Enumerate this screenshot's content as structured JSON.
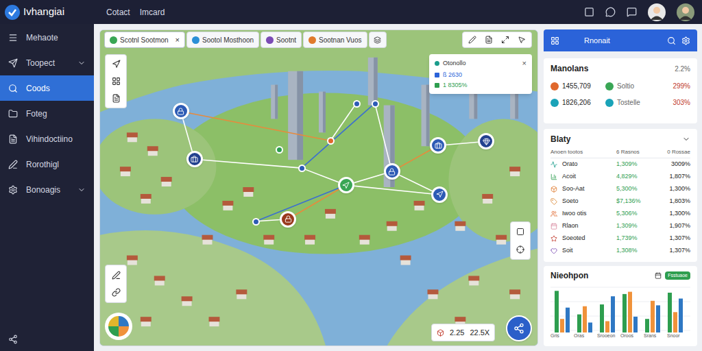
{
  "app": {
    "name": "Ivhangiai"
  },
  "top_menu": [
    "Cotact",
    "Imcard"
  ],
  "sidebar": {
    "items": [
      {
        "label": "Mehaote",
        "selected": false,
        "expandable": false
      },
      {
        "label": "Toopect",
        "selected": false,
        "expandable": true
      },
      {
        "label": "Coods",
        "selected": true,
        "expandable": false
      },
      {
        "label": "Foteg",
        "selected": false,
        "expandable": false
      },
      {
        "label": "Vihindoctiino",
        "selected": false,
        "expandable": false
      },
      {
        "label": "Rorothigl",
        "selected": false,
        "expandable": false
      },
      {
        "label": "Bonoagis",
        "selected": false,
        "expandable": true
      }
    ]
  },
  "map": {
    "tabs": [
      {
        "label": "Scotnl Sootmon",
        "selected": true,
        "closable": true,
        "color": "#3aa655"
      },
      {
        "label": "Sootol Mosthoon",
        "selected": false,
        "closable": false,
        "color": "#2b8fd6"
      },
      {
        "label": "Sootnt",
        "selected": false,
        "closable": false,
        "color": "#7b4bb5"
      },
      {
        "label": "Sootnan Vuos",
        "selected": false,
        "closable": false,
        "color": "#e07a2c"
      }
    ],
    "tab_close": "×",
    "popup": {
      "title": "Otonollo",
      "close": "×",
      "rows": [
        {
          "label": "ß 2630",
          "color": "#2b63d9"
        },
        {
          "label": "1 8305%",
          "color": "#2e9e4f"
        }
      ]
    },
    "pins": [
      {
        "kind": "marker",
        "color": "#2d5bb5"
      },
      {
        "kind": "marker",
        "color": "#23418f"
      },
      {
        "kind": "dot",
        "color": "#2e9e4f"
      },
      {
        "kind": "dot",
        "color": "#2d5bb5"
      },
      {
        "kind": "dot",
        "color": "#e0682c"
      },
      {
        "kind": "dot",
        "color": "#2d5bb5"
      },
      {
        "kind": "dot",
        "color": "#2d5bb5"
      },
      {
        "kind": "marker",
        "color": "#3aa655"
      },
      {
        "kind": "marker",
        "color": "#2d5bb5"
      },
      {
        "kind": "marker",
        "color": "#2d5bb5"
      },
      {
        "kind": "marker",
        "color": "#23418f"
      },
      {
        "kind": "marker",
        "color": "#2d5bb5"
      },
      {
        "kind": "marker",
        "color": "#9a3a1e"
      },
      {
        "kind": "dot",
        "color": "#2d5bb5"
      }
    ],
    "routes": [
      {
        "from": 0,
        "to": 4,
        "color": "#e88a3c"
      },
      {
        "from": 1,
        "to": 3,
        "color": "#ffffff"
      },
      {
        "from": 3,
        "to": 6,
        "color": "#3b6fd0"
      },
      {
        "from": 4,
        "to": 5,
        "color": "#ffffff"
      },
      {
        "from": 3,
        "to": 7,
        "color": "#ffffff"
      },
      {
        "from": 7,
        "to": 8,
        "color": "#ffffff"
      },
      {
        "from": 8,
        "to": 9,
        "color": "#e88a3c"
      },
      {
        "from": 9,
        "to": 10,
        "color": "#ffffff"
      },
      {
        "from": 7,
        "to": 11,
        "color": "#ffffff"
      },
      {
        "from": 7,
        "to": 12,
        "color": "#e88a3c"
      },
      {
        "from": 12,
        "to": 13,
        "color": "#ffffff"
      },
      {
        "from": 13,
        "to": 7,
        "color": "#3b6fd0"
      },
      {
        "from": 8,
        "to": 11,
        "color": "#ffffff"
      },
      {
        "from": 6,
        "to": 8,
        "color": "#ffffff"
      },
      {
        "from": 0,
        "to": 1,
        "color": "#ffffff"
      }
    ],
    "stats": {
      "value": "2.25",
      "ratio": "22.5X"
    }
  },
  "panel": {
    "title": "Rnonait"
  },
  "summary": {
    "title": "Manolans",
    "value": "2.2%",
    "rows": [
      {
        "amount": "1455,709",
        "name": "Soltio",
        "change": "299%",
        "color": "#e0682c",
        "badge_color": "#3aa655"
      },
      {
        "amount": "1826,206",
        "name": "Tostelle",
        "change": "303%",
        "color": "#1aa3b8",
        "badge_color": "#1aa3b8"
      }
    ]
  },
  "table": {
    "title": "Blaty",
    "columns": [
      "Anoen tootos",
      "6 Rasnos",
      "0 Rossae"
    ],
    "rows": [
      {
        "name": "Orato",
        "v1": "1,309%",
        "v2": "3009%",
        "color": "#1a9c8c"
      },
      {
        "name": "Acoit",
        "v1": "4,829%",
        "v2": "1,807%",
        "color": "#2e9e4f"
      },
      {
        "name": "Soo-Aat",
        "v1": "5,300%",
        "v2": "1,300%",
        "color": "#e07a2c"
      },
      {
        "name": "Soeto",
        "v1": "$7,136%",
        "v2": "1,803%",
        "color": "#d9822b"
      },
      {
        "name": "Iwoo otis",
        "v1": "5,306%",
        "v2": "1,300%",
        "color": "#e0682c"
      },
      {
        "name": "Rlaon",
        "v1": "1,309%",
        "v2": "1,907%",
        "color": "#d98aa0"
      },
      {
        "name": "Soeoted",
        "v1": "1,739%",
        "v2": "1,307%",
        "color": "#c0392b"
      },
      {
        "name": "Soit",
        "v1": "1,308%",
        "v2": "1,307%",
        "color": "#7b4bb5"
      }
    ]
  },
  "chart": {
    "title": "Nieohpon",
    "badge": "Fsstuaoe",
    "labels": [
      "Gris",
      "Oras",
      "Srooeon",
      "Oroos",
      "Srans",
      "Snoor"
    ],
    "series": [
      {
        "color": "#2e9e4f",
        "values": [
          92,
          40,
          62,
          85,
          30,
          88
        ]
      },
      {
        "color": "#f0923a",
        "values": [
          30,
          58,
          25,
          90,
          70,
          45
        ]
      },
      {
        "color": "#2f78c4",
        "values": [
          55,
          22,
          80,
          35,
          60,
          75
        ]
      }
    ]
  }
}
